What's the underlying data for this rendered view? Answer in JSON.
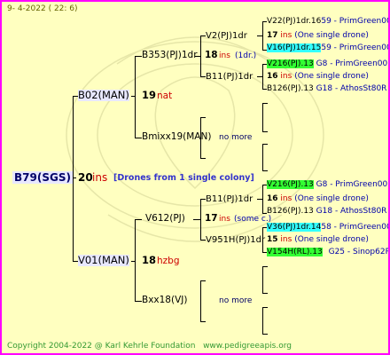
{
  "header": {
    "date": "9-  4-2022 ( 22:  6)"
  },
  "root": {
    "name": "B79(SGS)",
    "num": "20",
    "breeder": "ins",
    "note": "[Drones from 1 single colony]"
  },
  "gen1": [
    {
      "name": "B02(MAN)",
      "num": "19",
      "breeder": "nat"
    },
    {
      "name": "V01(MAN)",
      "num": "18",
      "breeder": "hzbg"
    }
  ],
  "gen2": [
    {
      "name": "B353(PJ)1dr",
      "num": "18",
      "breeder": "ins",
      "extra": "(1dr.)"
    },
    {
      "name": "Bmixx19(MAN)",
      "extra": "no more"
    },
    {
      "name": "V612(PJ)",
      "num": "17",
      "breeder": "ins",
      "extra": "(some c.)"
    },
    {
      "name": "Bxx18(VJ)",
      "extra": "no more"
    }
  ],
  "gen3": [
    {
      "name": "V2(PJ)1dr"
    },
    {
      "name": "B11(PJ)1dr"
    },
    {
      "name": "B11(PJ)1dr"
    },
    {
      "name": "V951H(PJ)1dr"
    }
  ],
  "gen4": [
    {
      "name": "V22(PJ)1dr.16",
      "tail": "59 - PrimGreen00"
    },
    {
      "num": "17",
      "breeder": "ins",
      "note": "(One single drone)"
    },
    {
      "name": "V16(PJ)1dr.15",
      "tail": "59 - PrimGreen00"
    },
    {
      "name": "V216(PJ).13",
      "tail": "G8 - PrimGreen00"
    },
    {
      "num": "16",
      "breeder": "ins",
      "note": "(One single drone)"
    },
    {
      "name": "B126(PJ).13",
      "tail": "G18 - AthosSt80R"
    },
    {
      "name": "V216(PJ).13",
      "tail": "G8 - PrimGreen00"
    },
    {
      "num": "16",
      "breeder": "ins",
      "note": "(One single drone)"
    },
    {
      "name": "B126(PJ).13",
      "tail": "G18 - AthosSt80R"
    },
    {
      "name": "V36(PJ)1dr.14",
      "tail": "58 - PrimGreen00"
    },
    {
      "num": "15",
      "breeder": "ins",
      "note": "(One single drone)"
    },
    {
      "name": "V154H(RL).13",
      "tail": "G25 - Sinop62R"
    }
  ],
  "footer": {
    "copyright": "Copyright 2004-2022 @ Karl Kehrle Foundation",
    "url": "www.pedigreeapis.org"
  }
}
